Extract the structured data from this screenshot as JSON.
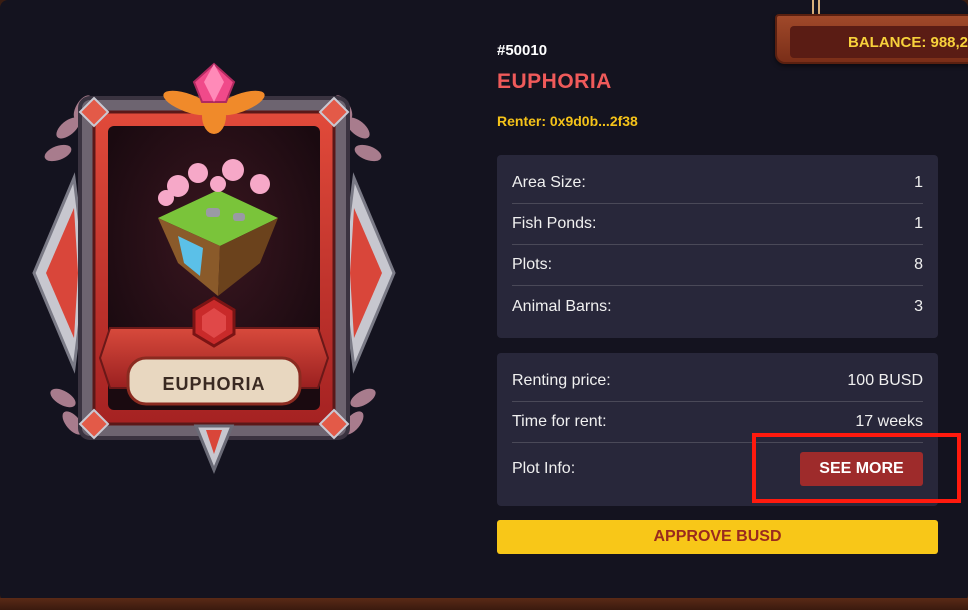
{
  "balance": {
    "label": "BALANCE: 988,2"
  },
  "card": {
    "banner_text": "EUPHORIA"
  },
  "nft": {
    "id": "#50010",
    "name": "EUPHORIA",
    "renter": "Renter: 0x9d0b...2f38"
  },
  "stats": [
    {
      "label": "Area Size:",
      "value": "1"
    },
    {
      "label": "Fish Ponds:",
      "value": "1"
    },
    {
      "label": "Plots:",
      "value": "8"
    },
    {
      "label": "Animal Barns:",
      "value": "3"
    }
  ],
  "rent": {
    "price_label": "Renting price:",
    "price_value": "100 BUSD",
    "time_label": "Time for rent:",
    "time_value": "17 weeks",
    "plot_info_label": "Plot Info:",
    "see_more_label": "SEE MORE"
  },
  "approve_label": "APPROVE BUSD",
  "colors": {
    "panel_bg": "#14131f",
    "box_bg": "#28273a",
    "name_red": "#ef5a5a",
    "renter_yellow": "#f5c319",
    "approve_yellow": "#f8c718",
    "see_more_red": "#9e2b2b",
    "highlight_red": "#ff1a0e"
  }
}
